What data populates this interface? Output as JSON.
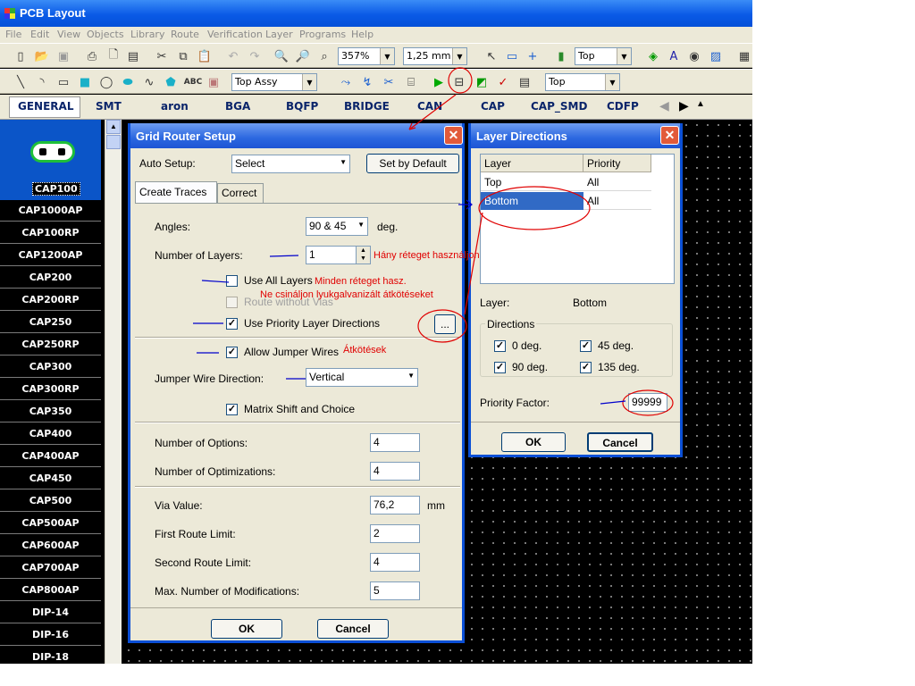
{
  "app": {
    "title": "PCB Layout"
  },
  "menu": [
    "File",
    "Edit",
    "View",
    "Objects",
    "Library",
    "Route",
    "Verification",
    "Layer",
    "Programs",
    "Help"
  ],
  "toolbar1": {
    "zoom": "357%",
    "grid": "1,25 mm",
    "layer": "Top"
  },
  "toolbar2": {
    "assy": "Top Assy",
    "layer": "Top",
    "abc": "ABC"
  },
  "library_tabs": [
    "GENERAL",
    "SMT",
    "aron",
    "BGA",
    "BQFP",
    "BRIDGE",
    "CAN",
    "CAP",
    "CAP_SMD",
    "CDFP"
  ],
  "components": {
    "selected": "CAP100",
    "items": [
      "CAP1000AP",
      "CAP100RP",
      "CAP1200AP",
      "CAP200",
      "CAP200RP",
      "CAP250",
      "CAP250RP",
      "CAP300",
      "CAP300RP",
      "CAP350",
      "CAP400",
      "CAP400AP",
      "CAP450",
      "CAP500",
      "CAP500AP",
      "CAP600AP",
      "CAP700AP",
      "CAP800AP",
      "DIP-14",
      "DIP-16",
      "DIP-18"
    ]
  },
  "grid_router": {
    "title": "Grid Router Setup",
    "auto_setup_label": "Auto Setup:",
    "auto_setup_value": "Select",
    "set_default": "Set by Default",
    "tab_create": "Create Traces",
    "tab_correct": "Correct",
    "angles_label": "Angles:",
    "angles_value": "90 & 45",
    "deg": "deg.",
    "layers_label": "Number of Layers:",
    "layers_value": "1",
    "use_all_layers": "Use All Layers",
    "route_without_vias": "Route without Vias",
    "use_priority": "Use Priority Layer Directions",
    "priority_btn": "...",
    "allow_jumper": "Allow Jumper Wires",
    "jumper_dir_label": "Jumper Wire Direction:",
    "jumper_dir_value": "Vertical",
    "matrix_shift": "Matrix Shift and Choice",
    "options_label": "Number of Options:",
    "options_value": "4",
    "optim_label": "Number of Optimizations:",
    "optim_value": "4",
    "via_label": "Via Value:",
    "via_value": "76,2",
    "mm": "mm",
    "first_label": "First Route Limit:",
    "first_value": "2",
    "second_label": "Second Route Limit:",
    "second_value": "4",
    "maxmod_label": "Max. Number of Modifications:",
    "maxmod_value": "5",
    "ok": "OK",
    "cancel": "Cancel"
  },
  "layer_dirs": {
    "title": "Layer Directions",
    "col_layer": "Layer",
    "col_priority": "Priority",
    "rows": [
      {
        "layer": "Top",
        "priority": "All"
      },
      {
        "layer": "Bottom",
        "priority": "All"
      }
    ],
    "layer_label": "Layer:",
    "layer_value": "Bottom",
    "directions_label": "Directions",
    "d0": "0 deg.",
    "d45": "45 deg.",
    "d90": "90 deg.",
    "d135": "135 deg.",
    "priority_label": "Priority Factor:",
    "priority_value": "99999",
    "ok": "OK",
    "cancel": "Cancel"
  },
  "annotations": {
    "layers_note": "Hány réteget használjon",
    "all_layers_note": "Minden réteget hasz.",
    "vias_note": "Ne csináljon lyukgalvanizált átkötéseket",
    "jumper_note": "Átkötések"
  }
}
